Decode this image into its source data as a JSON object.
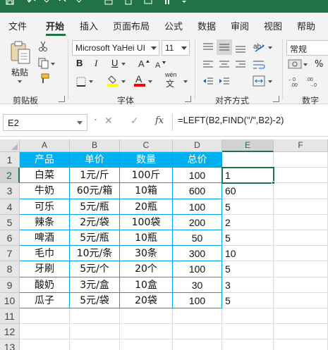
{
  "ribbon": {
    "tabs": [
      {
        "label": "文件",
        "name": "tab-file"
      },
      {
        "label": "开始",
        "name": "tab-home",
        "active": true
      },
      {
        "label": "插入",
        "name": "tab-insert"
      },
      {
        "label": "页面布局",
        "name": "tab-page-layout"
      },
      {
        "label": "公式",
        "name": "tab-formulas"
      },
      {
        "label": "数据",
        "name": "tab-data"
      },
      {
        "label": "审阅",
        "name": "tab-review"
      },
      {
        "label": "视图",
        "name": "tab-view"
      },
      {
        "label": "帮助",
        "name": "tab-help"
      }
    ],
    "clipboard": {
      "paste_label": "粘贴",
      "group_label": "剪贴板"
    },
    "font": {
      "font_name": "Microsoft YaHei UI",
      "font_size": "11",
      "group_label": "字体",
      "phonetic_label": "wén",
      "phonetic_char": "文",
      "bold": "B",
      "italic": "I",
      "underline": "U",
      "font_color_glyph": "A"
    },
    "alignment": {
      "group_label": "对齐方式"
    },
    "number": {
      "format": "常规",
      "group_label": "数字"
    }
  },
  "formula_bar": {
    "name_box": "E2",
    "cancel": "✕",
    "enter": "✓",
    "fx": "fx",
    "formula": "=LEFT(B2,FIND(\"/\",B2)-2)"
  },
  "grid": {
    "columns": [
      "A",
      "B",
      "C",
      "D",
      "E",
      "F"
    ],
    "selected_column": "E",
    "rows": [
      "1",
      "2",
      "3",
      "4",
      "5",
      "6",
      "7",
      "8",
      "9",
      "10",
      "11",
      "12",
      "13"
    ],
    "selected_row": "2",
    "header": [
      "产品",
      "单价",
      "数量",
      "总价"
    ],
    "data": [
      [
        "白菜",
        "1元/斤",
        "100斤",
        "100",
        "1"
      ],
      [
        "牛奶",
        "60元/箱",
        "10箱",
        "600",
        "60"
      ],
      [
        "可乐",
        "5元/瓶",
        "20瓶",
        "100",
        "5"
      ],
      [
        "辣条",
        "2元/袋",
        "100袋",
        "200",
        "2"
      ],
      [
        "啤酒",
        "5元/瓶",
        "10瓶",
        "50",
        "5"
      ],
      [
        "毛巾",
        "10元/条",
        "30条",
        "300",
        "10"
      ],
      [
        "牙刷",
        "5元/个",
        "20个",
        "100",
        "5"
      ],
      [
        "酸奶",
        "3元/盒",
        "10盒",
        "30",
        "3"
      ],
      [
        "瓜子",
        "5元/袋",
        "20袋",
        "100",
        "5"
      ]
    ],
    "colors": {
      "header_fill": "#00b0f0",
      "table_border": "#00a2e8",
      "selection": "#217346"
    }
  }
}
